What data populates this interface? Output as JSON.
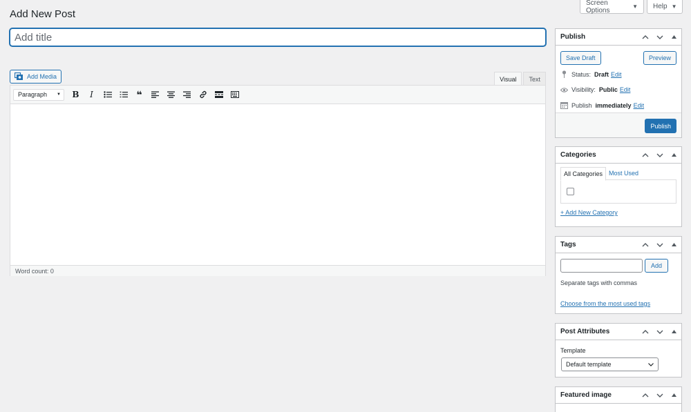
{
  "top_bar": {
    "screen_options": "Screen Options",
    "help": "Help",
    "caret": "▼"
  },
  "page": {
    "title": "Add New Post",
    "title_placeholder": "Add title"
  },
  "editor": {
    "add_media_label": "Add Media",
    "tab_visual": "Visual",
    "tab_text": "Text",
    "format_value": "Paragraph",
    "word_count": "Word count: 0",
    "toolbar_icons": [
      "bold-icon",
      "italic-icon",
      "bulleted-list-icon",
      "numbered-list-icon",
      "blockquote-icon",
      "align-left-icon",
      "align-center-icon",
      "align-right-icon",
      "insert-link-icon",
      "read-more-icon",
      "toolbar-toggle-icon"
    ]
  },
  "publish_box": {
    "title": "Publish",
    "save_draft": "Save Draft",
    "preview": "Preview",
    "status_label": "Status:",
    "status_value": "Draft",
    "visibility_label": "Visibility:",
    "visibility_value": "Public",
    "publish_label": "Publish",
    "publish_value": "immediately",
    "edit_link": "Edit",
    "publish_button": "Publish"
  },
  "categories_box": {
    "title": "Categories",
    "tab_all": "All Categories",
    "tab_most_used": "Most Used",
    "add_new": "+ Add New Category"
  },
  "tags_box": {
    "title": "Tags",
    "add_button": "Add",
    "help": "Separate tags with commas",
    "choose_link": "Choose from the most used tags"
  },
  "attributes_box": {
    "title": "Post Attributes",
    "template_label": "Template",
    "template_value": "Default template"
  },
  "featured_box": {
    "title": "Featured image"
  },
  "colors": {
    "accent": "#2271b1",
    "background": "#f0f0f1"
  }
}
